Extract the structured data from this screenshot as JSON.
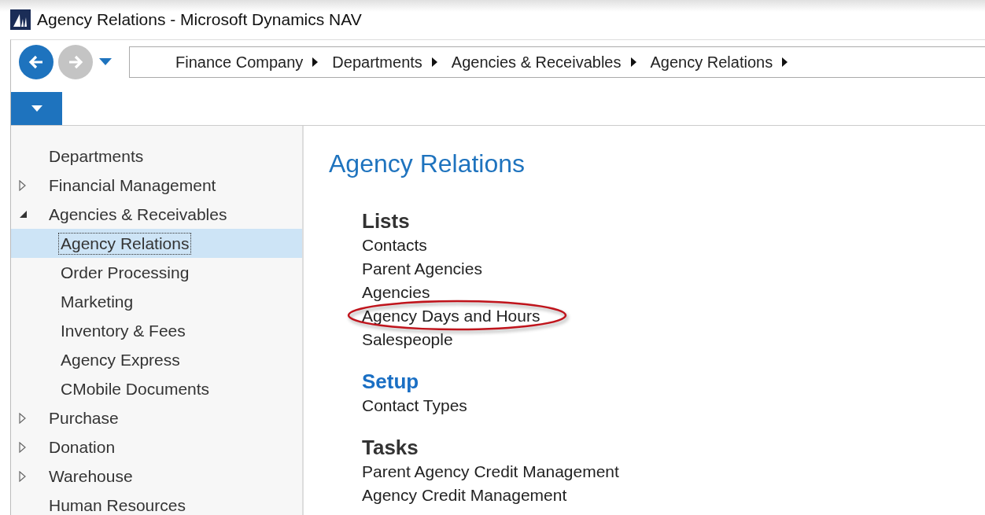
{
  "window": {
    "title": "Agency Relations - Microsoft Dynamics NAV"
  },
  "breadcrumb": [
    "Finance Company",
    "Departments",
    "Agencies & Receivables",
    "Agency Relations"
  ],
  "navigation": [
    {
      "label": "Departments",
      "kind": "link",
      "selected": false
    },
    {
      "label": "Financial Management",
      "kind": "group",
      "expanded": false,
      "selected": false
    },
    {
      "label": "Agencies & Receivables",
      "kind": "group",
      "expanded": true,
      "selected": false,
      "children": [
        {
          "label": "Agency Relations",
          "selected": true
        },
        {
          "label": "Order Processing",
          "selected": false
        },
        {
          "label": "Marketing",
          "selected": false
        },
        {
          "label": "Inventory & Fees",
          "selected": false
        },
        {
          "label": "Agency Express",
          "selected": false
        },
        {
          "label": "CMobile Documents",
          "selected": false
        }
      ]
    },
    {
      "label": "Purchase",
      "kind": "group",
      "expanded": false,
      "selected": false
    },
    {
      "label": "Donation",
      "kind": "group",
      "expanded": false,
      "selected": false
    },
    {
      "label": "Warehouse",
      "kind": "group",
      "expanded": false,
      "selected": false
    },
    {
      "label": "Human Resources",
      "kind": "link",
      "selected": false
    }
  ],
  "page": {
    "title": "Agency Relations",
    "sections": [
      {
        "heading": "Lists",
        "color": "#333333",
        "items": [
          {
            "label": "Contacts",
            "circled": false
          },
          {
            "label": "Parent Agencies",
            "circled": false
          },
          {
            "label": "Agencies",
            "circled": false
          },
          {
            "label": "Agency Days and Hours",
            "circled": true
          },
          {
            "label": "Salespeople",
            "circled": false
          }
        ]
      },
      {
        "heading": "Setup",
        "color": "#1a6fc4",
        "items": [
          {
            "label": "Contact Types",
            "circled": false
          }
        ]
      },
      {
        "heading": "Tasks",
        "color": "#333333",
        "items": [
          {
            "label": "Parent Agency Credit Management",
            "circled": false
          },
          {
            "label": "Agency Credit Management",
            "circled": false
          }
        ]
      }
    ]
  }
}
